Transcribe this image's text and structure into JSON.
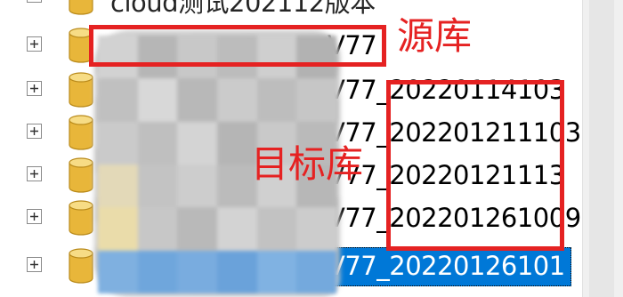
{
  "tree": {
    "partial_top": {
      "label": "cloud测试202112版本"
    },
    "rows": [
      {
        "name": "V77",
        "selected": false
      },
      {
        "name": "V77_20220114103",
        "selected": false
      },
      {
        "name": "V77_202201211103",
        "selected": false
      },
      {
        "name": "V77_20220121113",
        "selected": false
      },
      {
        "name": "V77_202201261009",
        "selected": false
      },
      {
        "name": "V77_20220126101",
        "selected": true
      }
    ]
  },
  "annotations": {
    "source_label": "源库",
    "target_label": "目标库",
    "color": "#e52222"
  },
  "colors": {
    "selection": "#0078d7",
    "db_icon": "#e8b63a"
  }
}
